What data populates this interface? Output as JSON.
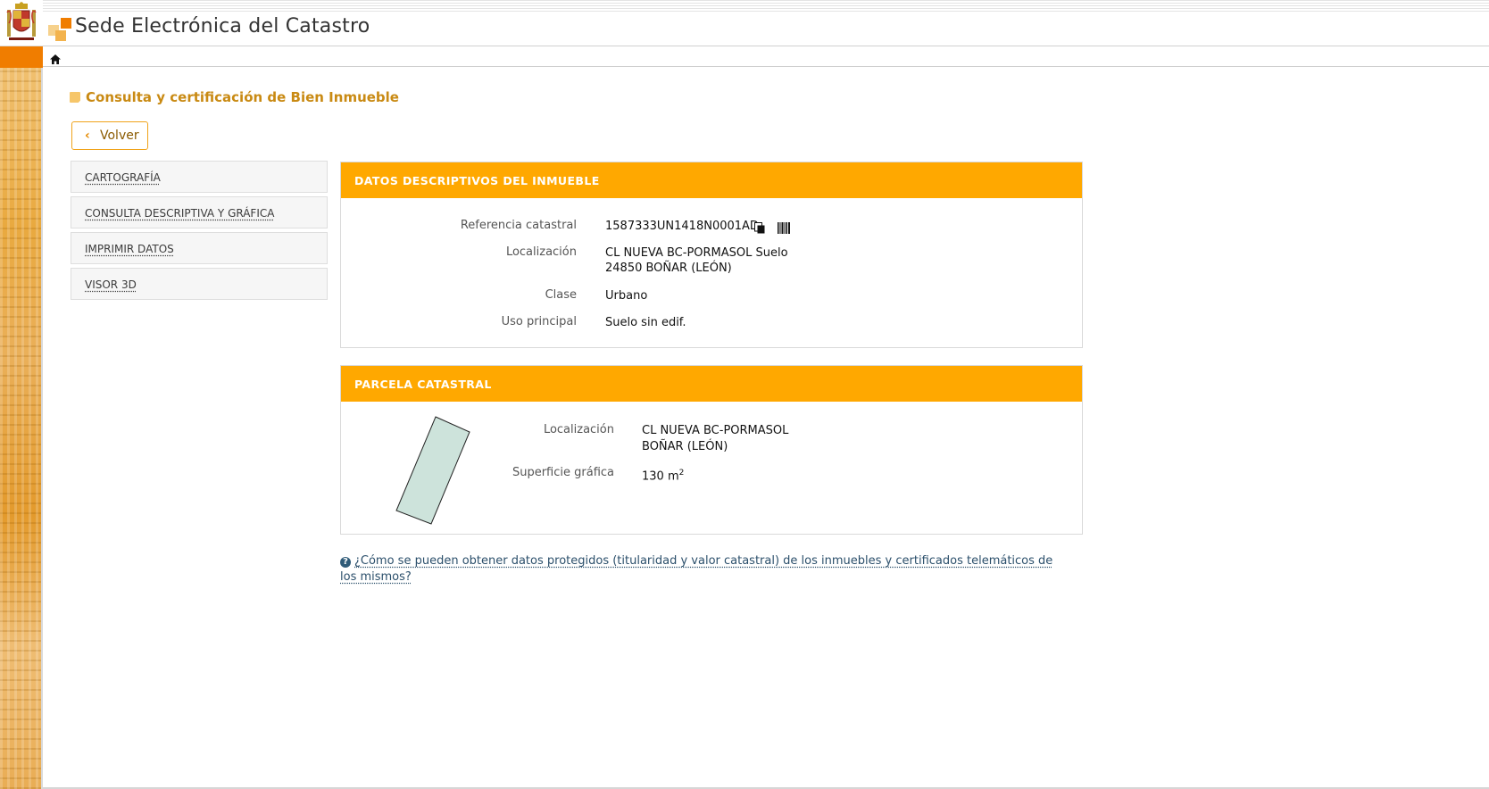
{
  "header": {
    "site_title": "Sede Electrónica del Catastro"
  },
  "page": {
    "heading": "Consulta y certificación de Bien Inmueble",
    "back_label": "Volver"
  },
  "menu": {
    "items": [
      {
        "label": "CARTOGRAFÍA"
      },
      {
        "label": "CONSULTA DESCRIPTIVA Y GRÁFICA"
      },
      {
        "label": "IMPRIMIR DATOS"
      },
      {
        "label": "VISOR 3D"
      }
    ]
  },
  "datos": {
    "title": "DATOS DESCRIPTIVOS DEL INMUEBLE",
    "referencia_label": "Referencia catastral",
    "referencia_value": "1587333UN1418N0001AD",
    "localizacion_label": "Localización",
    "localizacion_line1": "CL NUEVA BC-PORMASOL Suelo",
    "localizacion_line2": "24850 BOÑAR (LEÓN)",
    "clase_label": "Clase",
    "clase_value": "Urbano",
    "uso_label": "Uso principal",
    "uso_value": "Suelo sin edif."
  },
  "parcela": {
    "title": "PARCELA CATASTRAL",
    "localizacion_label": "Localización",
    "localizacion_line1": "CL NUEVA BC-PORMASOL",
    "localizacion_line2": "BOÑAR (LEÓN)",
    "superficie_label": "Superficie gráfica",
    "superficie_value": "130 m",
    "superficie_unit_sup": "2",
    "parcel_fill": "#cde3db"
  },
  "footer": {
    "info_link": "¿Cómo se pueden obtener datos protegidos (titularidad y valor catastral) de los inmuebles y certificados telemáticos de los mismos?"
  },
  "colors": {
    "accent": "#ffa800",
    "header_orange": "#f07d00",
    "heading": "#c98a13",
    "link": "#2b4f6b"
  }
}
